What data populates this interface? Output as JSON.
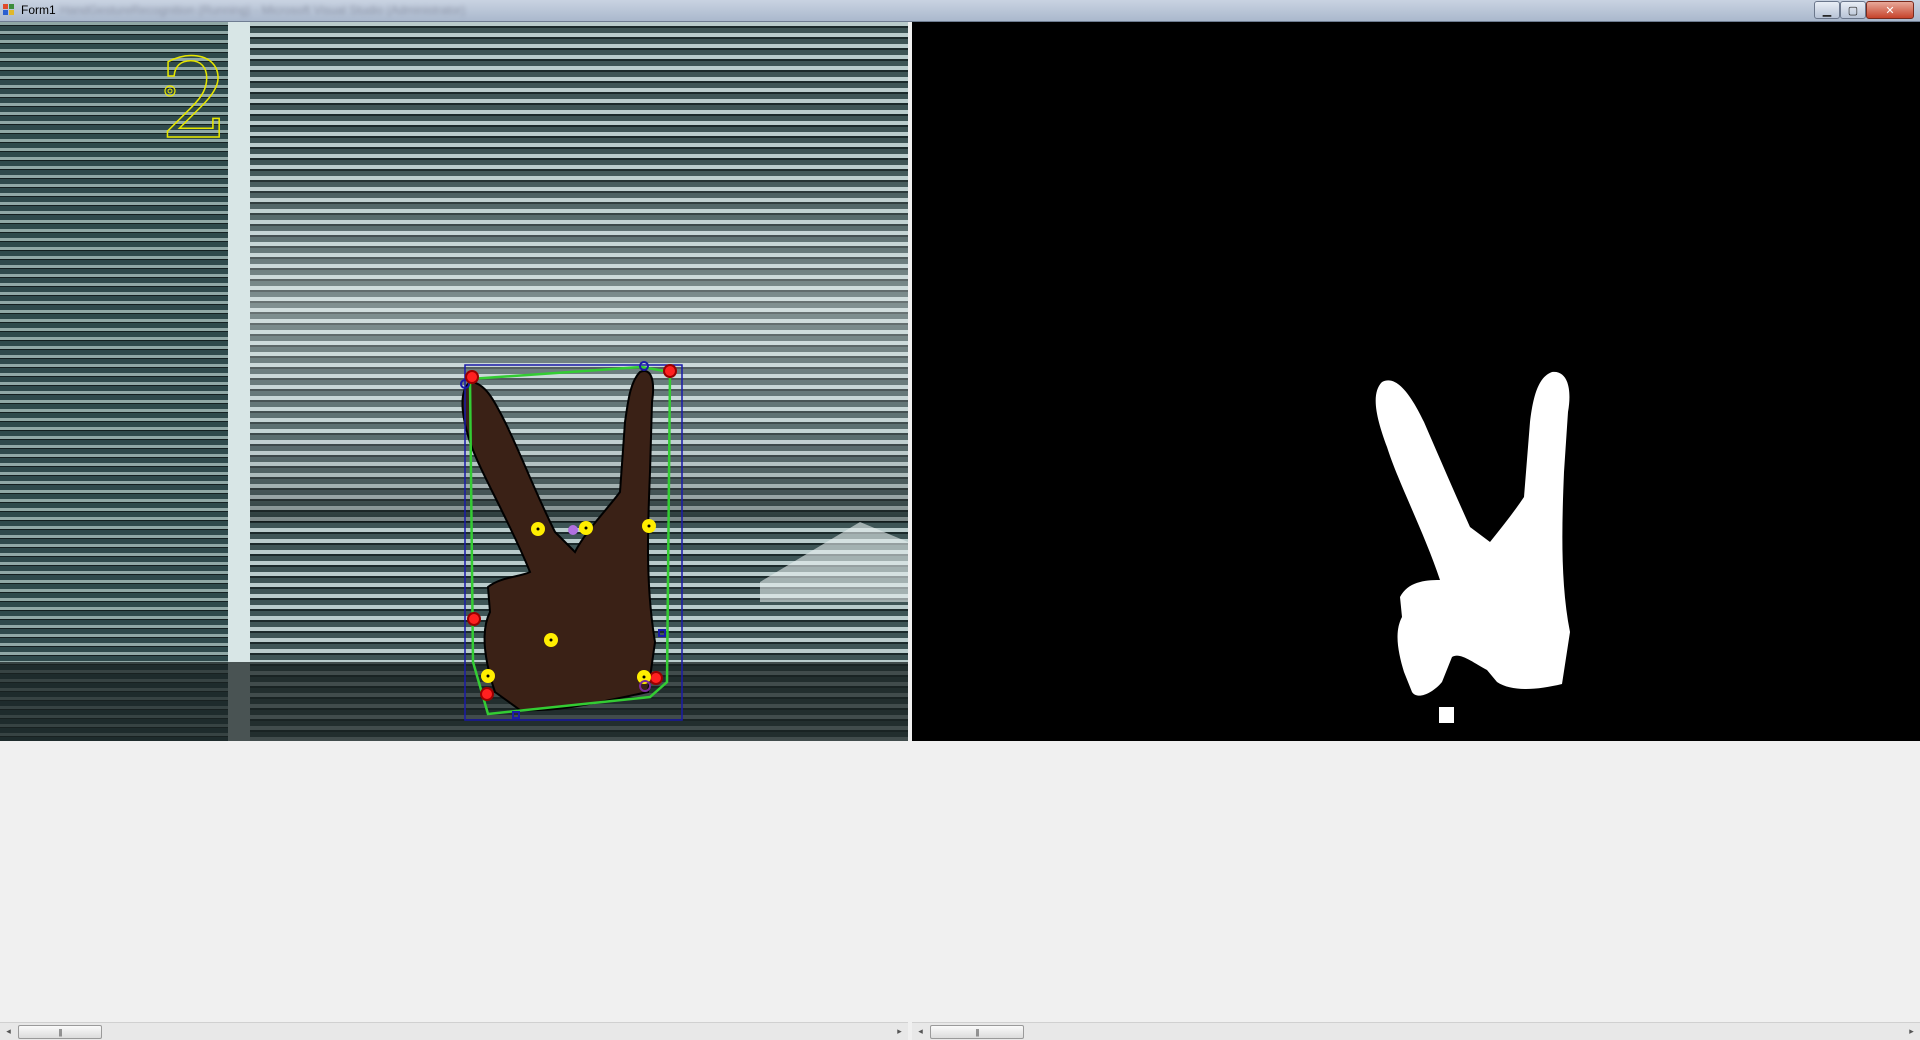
{
  "window": {
    "title": "Form1",
    "background_title": "HandGestureRecognition (Running) - Microsoft Visual Studio (Administrator)",
    "controls": [
      "minimize-icon",
      "maximize-icon",
      "close-icon"
    ]
  },
  "left_pane": {
    "gesture_count": "2",
    "overlay_colors": {
      "hull": "#33cc33",
      "bounding_box": "#1a1aa8",
      "defect_start": "#ff2020",
      "defect_depth": "#ffee00",
      "contour": "#000000",
      "count_text": "#e6e600"
    }
  },
  "right_pane": {
    "description_color": "#ffffff"
  },
  "scrollbars": {
    "thumb_glyph": "|||",
    "left_arrow": "◂",
    "right_arrow": "▸"
  }
}
